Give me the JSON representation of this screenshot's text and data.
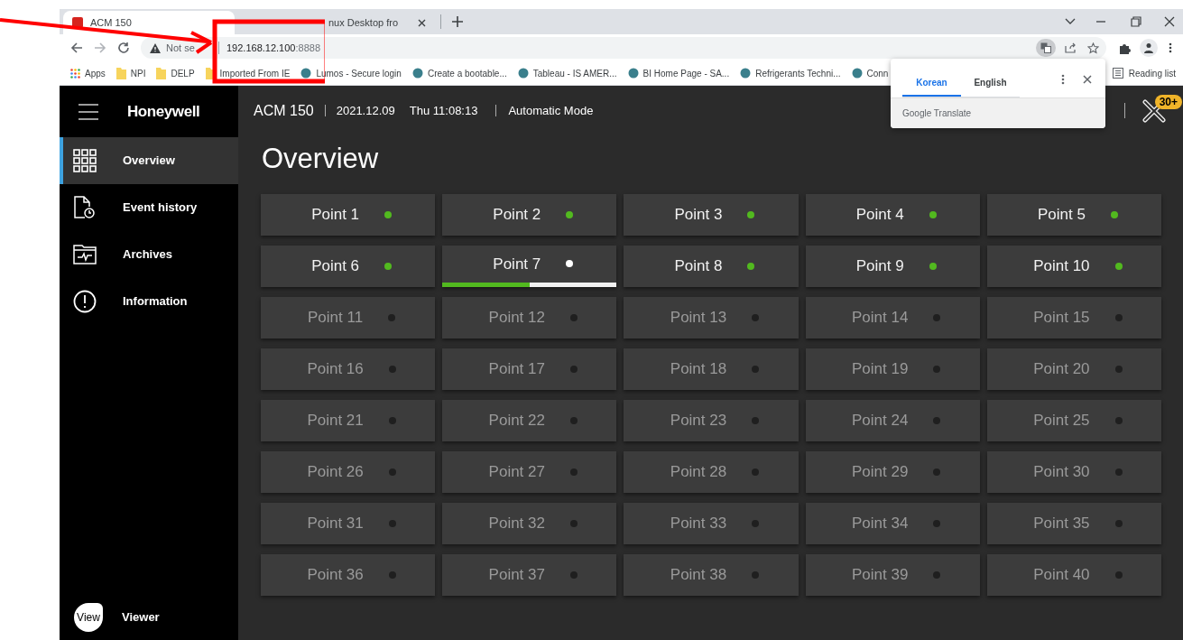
{
  "browser": {
    "tabs": [
      {
        "title": "ACM 150",
        "selected": true
      },
      {
        "title": "nux Desktop fro",
        "selected": false
      }
    ],
    "address": {
      "security": "Not se",
      "host": "192.168.12.100",
      "port": ":8888"
    },
    "bookmarks": [
      {
        "label": "Apps",
        "kind": "apps"
      },
      {
        "label": "NPI",
        "kind": "folder"
      },
      {
        "label": "DELP",
        "kind": "folder"
      },
      {
        "label": "Imported From IE",
        "kind": "folder"
      },
      {
        "label": "Lumos - Secure login",
        "kind": "site"
      },
      {
        "label": "Create a bootable...",
        "kind": "site"
      },
      {
        "label": "Tableau - IS AMER...",
        "kind": "site"
      },
      {
        "label": "BI Home Page - SA...",
        "kind": "site"
      },
      {
        "label": "Refrigerants Techni...",
        "kind": "site"
      },
      {
        "label": "Conn",
        "kind": "site"
      }
    ],
    "reading_list": "Reading list"
  },
  "translate_popup": {
    "tabs": [
      {
        "label": "Korean",
        "selected": true
      },
      {
        "label": "English",
        "selected": false
      }
    ],
    "footer": "Google Translate"
  },
  "app": {
    "brand": "Honeywell",
    "header": {
      "device": "ACM 150",
      "date": "2021.12.09",
      "time": "Thu 11:08:13",
      "mode": "Automatic Mode",
      "badge": "30+"
    },
    "sidebar": {
      "items": [
        {
          "label": "Overview",
          "kind": "grid",
          "selected": true
        },
        {
          "label": "Event history",
          "kind": "history",
          "selected": false
        },
        {
          "label": "Archives",
          "kind": "archive",
          "selected": false
        },
        {
          "label": "Information",
          "kind": "info",
          "selected": false
        }
      ],
      "footer": {
        "badge": "View",
        "label": "Viewer"
      }
    },
    "page_title": "Overview",
    "points": [
      {
        "label": "Point 1",
        "enabled": true,
        "color": "#52b91f"
      },
      {
        "label": "Point 2",
        "enabled": true,
        "color": "#52b91f"
      },
      {
        "label": "Point 3",
        "enabled": true,
        "color": "#52b91f"
      },
      {
        "label": "Point 4",
        "enabled": true,
        "color": "#52b91f"
      },
      {
        "label": "Point 5",
        "enabled": true,
        "color": "#52b91f"
      },
      {
        "label": "Point 6",
        "enabled": true,
        "color": "#52b91f"
      },
      {
        "label": "Point 7",
        "enabled": true,
        "color": "#ffffff",
        "level": 0.5
      },
      {
        "label": "Point 8",
        "enabled": true,
        "color": "#52b91f"
      },
      {
        "label": "Point 9",
        "enabled": true,
        "color": "#52b91f"
      },
      {
        "label": "Point 10",
        "enabled": true,
        "color": "#52b91f"
      },
      {
        "label": "Point 11",
        "enabled": false,
        "color": "#1f1f1f"
      },
      {
        "label": "Point 12",
        "enabled": false,
        "color": "#1f1f1f"
      },
      {
        "label": "Point 13",
        "enabled": false,
        "color": "#1f1f1f"
      },
      {
        "label": "Point 14",
        "enabled": false,
        "color": "#1f1f1f"
      },
      {
        "label": "Point 15",
        "enabled": false,
        "color": "#1f1f1f"
      },
      {
        "label": "Point 16",
        "enabled": false,
        "color": "#1f1f1f"
      },
      {
        "label": "Point 17",
        "enabled": false,
        "color": "#1f1f1f"
      },
      {
        "label": "Point 18",
        "enabled": false,
        "color": "#1f1f1f"
      },
      {
        "label": "Point 19",
        "enabled": false,
        "color": "#1f1f1f"
      },
      {
        "label": "Point 20",
        "enabled": false,
        "color": "#1f1f1f"
      },
      {
        "label": "Point 21",
        "enabled": false,
        "color": "#1f1f1f"
      },
      {
        "label": "Point 22",
        "enabled": false,
        "color": "#1f1f1f"
      },
      {
        "label": "Point 23",
        "enabled": false,
        "color": "#1f1f1f"
      },
      {
        "label": "Point 24",
        "enabled": false,
        "color": "#1f1f1f"
      },
      {
        "label": "Point 25",
        "enabled": false,
        "color": "#1f1f1f"
      },
      {
        "label": "Point 26",
        "enabled": false,
        "color": "#1f1f1f"
      },
      {
        "label": "Point 27",
        "enabled": false,
        "color": "#1f1f1f"
      },
      {
        "label": "Point 28",
        "enabled": false,
        "color": "#1f1f1f"
      },
      {
        "label": "Point 29",
        "enabled": false,
        "color": "#1f1f1f"
      },
      {
        "label": "Point 30",
        "enabled": false,
        "color": "#1f1f1f"
      },
      {
        "label": "Point 31",
        "enabled": false,
        "color": "#1f1f1f"
      },
      {
        "label": "Point 32",
        "enabled": false,
        "color": "#1f1f1f"
      },
      {
        "label": "Point 33",
        "enabled": false,
        "color": "#1f1f1f"
      },
      {
        "label": "Point 34",
        "enabled": false,
        "color": "#1f1f1f"
      },
      {
        "label": "Point 35",
        "enabled": false,
        "color": "#1f1f1f"
      },
      {
        "label": "Point 36",
        "enabled": false,
        "color": "#1f1f1f"
      },
      {
        "label": "Point 37",
        "enabled": false,
        "color": "#1f1f1f"
      },
      {
        "label": "Point 38",
        "enabled": false,
        "color": "#1f1f1f"
      },
      {
        "label": "Point 39",
        "enabled": false,
        "color": "#1f1f1f"
      },
      {
        "label": "Point 40",
        "enabled": false,
        "color": "#1f1f1f"
      }
    ]
  }
}
